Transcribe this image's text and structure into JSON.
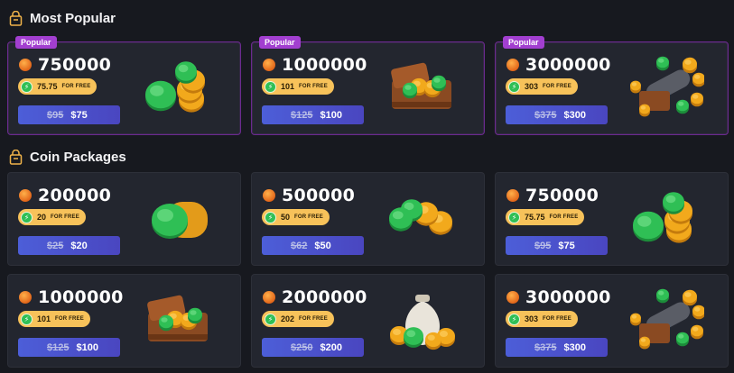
{
  "sections": {
    "popular": {
      "title": "Most Popular"
    },
    "packages": {
      "title": "Coin Packages"
    }
  },
  "popular_cards": [
    {
      "badge": "Popular",
      "amount": "750000",
      "free_value": "75.75",
      "free_label": "FOR FREE",
      "old_price": "$95",
      "new_price": "$75",
      "art": "coin-stack-icon"
    },
    {
      "badge": "Popular",
      "amount": "1000000",
      "free_value": "101",
      "free_label": "FOR FREE",
      "old_price": "$125",
      "new_price": "$100",
      "art": "treasure-chest-icon"
    },
    {
      "badge": "Popular",
      "amount": "3000000",
      "free_value": "303",
      "free_label": "FOR FREE",
      "old_price": "$375",
      "new_price": "$300",
      "art": "cannon-icon"
    }
  ],
  "package_cards": [
    {
      "amount": "200000",
      "free_value": "20",
      "free_label": "FOR FREE",
      "old_price": "$25",
      "new_price": "$20",
      "art": "coin-roll-icon"
    },
    {
      "amount": "500000",
      "free_value": "50",
      "free_label": "FOR FREE",
      "old_price": "$62",
      "new_price": "$50",
      "art": "coin-pile-icon"
    },
    {
      "amount": "750000",
      "free_value": "75.75",
      "free_label": "FOR FREE",
      "old_price": "$95",
      "new_price": "$75",
      "art": "coin-stack-icon"
    },
    {
      "amount": "1000000",
      "free_value": "101",
      "free_label": "FOR FREE",
      "old_price": "$125",
      "new_price": "$100",
      "art": "treasure-chest-icon"
    },
    {
      "amount": "2000000",
      "free_value": "202",
      "free_label": "FOR FREE",
      "old_price": "$250",
      "new_price": "$200",
      "art": "money-bag-icon"
    },
    {
      "amount": "3000000",
      "free_value": "303",
      "free_label": "FOR FREE",
      "old_price": "$375",
      "new_price": "$300",
      "art": "cannon-icon"
    }
  ],
  "colors": {
    "background": "#17191f",
    "card": "#23262f",
    "popular_badge": "#a23fd0",
    "free_pill": "#f7c25a",
    "button": "#4c5ed8",
    "coin_gold": "#f2a91c",
    "coin_green": "#2fbf55"
  }
}
